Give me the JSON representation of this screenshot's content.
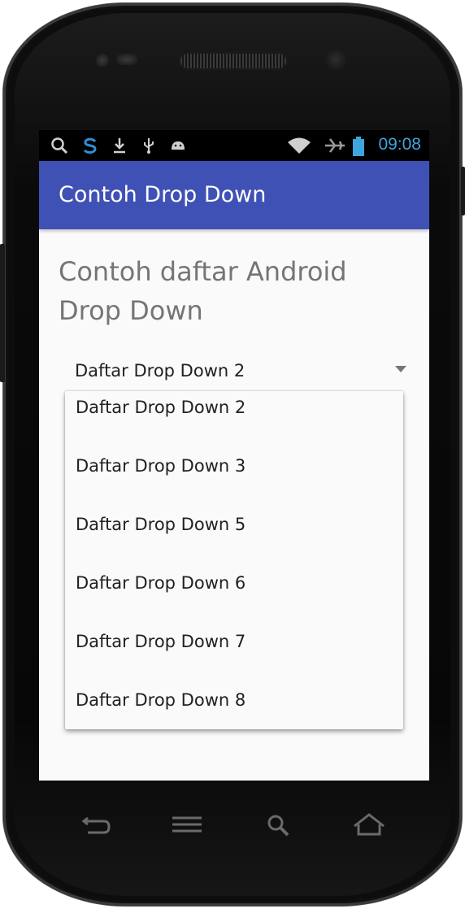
{
  "status_bar": {
    "time": "09:08",
    "left_icons": [
      "search-icon",
      "sync-icon",
      "download-icon",
      "usb-icon",
      "android-debug-icon"
    ],
    "right_icons": [
      "wifi-icon",
      "airplane-icon",
      "battery-icon"
    ],
    "time_color": "#3fa5de"
  },
  "app_bar": {
    "title": "Contoh Drop Down",
    "color": "#3f51b5"
  },
  "main": {
    "heading": "Contoh daftar Android Drop Down",
    "spinner": {
      "selected": "Daftar Drop Down 2"
    },
    "dropdown_options": [
      "Daftar Drop Down 2",
      "Daftar Drop Down 3",
      "Daftar Drop Down 5",
      "Daftar Drop Down 6",
      "Daftar Drop Down 7",
      "Daftar Drop Down 8"
    ]
  },
  "nav_bar": {
    "buttons": [
      "back-icon",
      "menu-icon",
      "search-icon",
      "home-icon"
    ]
  }
}
